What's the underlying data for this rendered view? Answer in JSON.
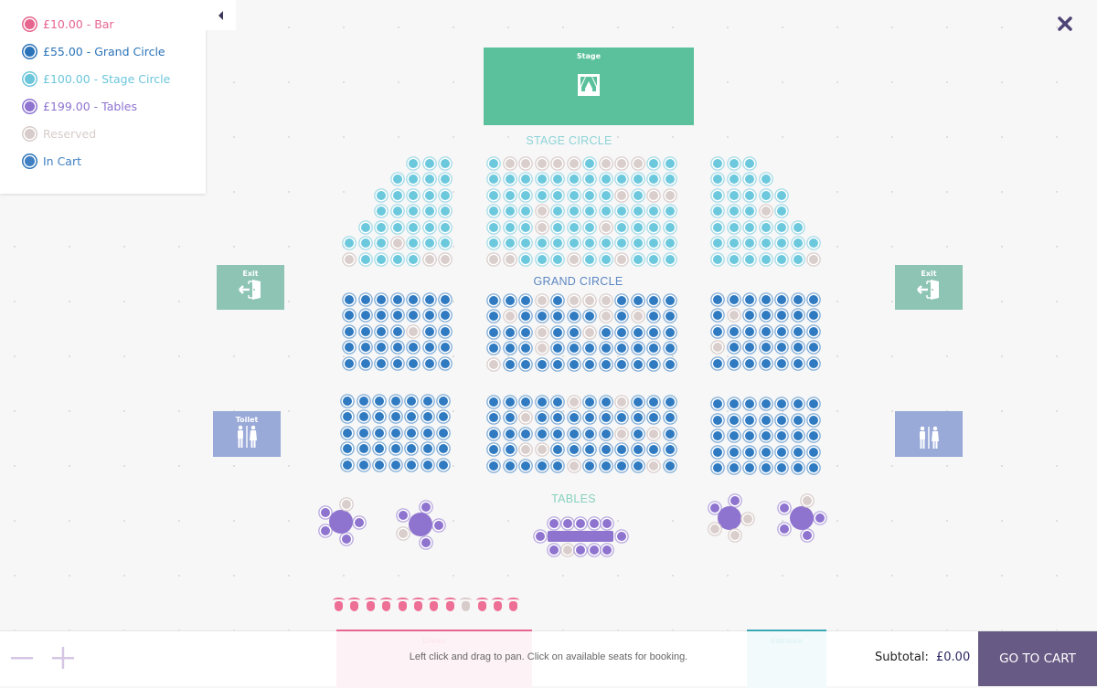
{
  "legend": {
    "items": [
      {
        "label": "£10.00 - Bar",
        "color": "#e6668f",
        "ring": "#e6668f"
      },
      {
        "label": "£55.00 - Grand Circle",
        "color": "#2b73b8",
        "ring": "#2b73b8"
      },
      {
        "label": "£100.00 - Stage Circle",
        "color": "#6cc6db",
        "ring": "#6cc6db"
      },
      {
        "label": "£199.00 - Tables",
        "color": "#8e73cf",
        "ring": "#8e73cf"
      },
      {
        "label": "Reserved",
        "color": "#d8ccca",
        "ring": "#d8ccca"
      },
      {
        "label": "In Cart",
        "color": "#3f7fc3",
        "ring": "#2b73b8"
      }
    ],
    "toggle_icon": "caret-left-icon"
  },
  "colors": {
    "bar": "#ee6f96",
    "grand_circle": "#2f7ac0",
    "stage_circle": "#6cc8dc",
    "tables": "#8e73cf",
    "reserved": "#d8ccca",
    "stage_fill": "#5bc19d",
    "exit_fill": "#8dc4b3",
    "toilet_fill": "#99a9d8",
    "cart_button": "#675a84"
  },
  "areas": {
    "stage": {
      "label": "Stage",
      "icon": "curtain-icon"
    },
    "exit_left": {
      "label": "Exit",
      "icon": "exit-door-icon"
    },
    "exit_right": {
      "label": "Exit",
      "icon": "exit-door-icon"
    },
    "toilet_left": {
      "label": "Toilet",
      "icon": "toilet-icon"
    },
    "toilet_right": {
      "label": "",
      "icon": "toilet-icon"
    },
    "drinks": {
      "label": "Drinks",
      "icon": "drinks-icon"
    },
    "entrance": {
      "label": "Entrance",
      "icon": "entrance-icon"
    }
  },
  "sections": {
    "stage_circle_label": "STAGE CIRCLE",
    "grand_circle_label": "GRAND CIRCLE",
    "tables_label": "TABLES"
  },
  "seating": {
    "stage_circle_left": [
      "___AAA",
      "__AAAA",
      "_AAAAA",
      "_AAAAA",
      "AAAAAA",
      "AAARAAA",
      "RAAAARR"
    ],
    "stage_circle_center": [
      "ARRRRRARRRAA",
      "AAAAAAAAAAAA",
      "AAAAAAAARARR",
      "AAARAAAAAAAA",
      "AAARAAARAAAA",
      "AAAAAAAAAAAA",
      "RRAAARAARAAA"
    ],
    "stage_circle_right": [
      "AAA",
      "AAAA",
      "AAAAA",
      "AAARA",
      "AAAAAA",
      "AAAAAAA",
      "AAAAAAR"
    ],
    "grand_upper_left": [
      "AAAAAAA",
      "AAAAAAA",
      "AAAARAA",
      "AAAAAAA",
      "AAAAAAA"
    ],
    "grand_upper_center": [
      "AAARARRRAAAA",
      "ARAAAAARARAA",
      "AAARAARAAAAA",
      "AAARAAAAAAAA",
      "RAAAAAAAAAAA"
    ],
    "grand_upper_right": [
      "AAAAAAA",
      "ARAAAAA",
      "AAAAAAA",
      "RAAAAAA",
      "AAAAAAA"
    ],
    "grand_lower_left": [
      "AAAAAAA",
      "AAAAAAA",
      "AAAAAAA",
      "AAAAAAA",
      "AAAAAAA"
    ],
    "grand_lower_center": [
      "AAAAARAARAAA",
      "AARAAAAAAAAA",
      "AAAAAAAARARA",
      "AARRAAAAAAAA",
      "AAAAARAAAARA"
    ],
    "grand_lower_right": [
      "AAAAAAA",
      "AAAAAAA",
      "AAAAAAA",
      "AAAAAAA",
      "AAAAAAA"
    ],
    "tables_round": [
      {
        "seats": [
          "A",
          "R",
          "A",
          "A",
          "A"
        ]
      },
      {
        "seats": [
          "A",
          "A",
          "A",
          "R",
          "A"
        ]
      },
      {
        "seats": [
          "A",
          "A",
          "R",
          "R",
          "R"
        ]
      },
      {
        "seats": [
          "A",
          "R",
          "A",
          "A",
          "A"
        ]
      }
    ],
    "table_long": {
      "top": "AAAAA",
      "bottom": "ARAAA",
      "left": "A",
      "right": "A"
    },
    "bar": "AAAAAAAARAAA"
  },
  "footer": {
    "zoom_out_icon": "minus-icon",
    "zoom_in_icon": "plus-icon",
    "hint": "Left click and drag to pan. Click on available seats for booking.",
    "subtotal_label": "Subtotal:",
    "subtotal_value": "£0.00",
    "cart_button": "GO TO CART"
  },
  "close_icon": "close-icon"
}
